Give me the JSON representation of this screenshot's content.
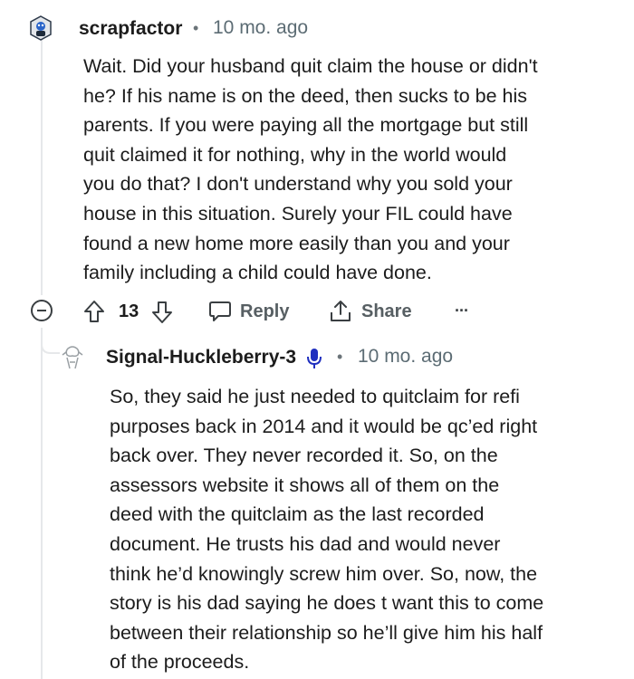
{
  "comment": {
    "username": "scrapfactor",
    "separator": "•",
    "time": "10 mo. ago",
    "lines": [
      "Wait. Did your husband quit claim the house or didn't",
      "he? If his name is on the deed, then sucks to be his",
      "parents. If you were paying all the mortgage but still",
      "quit claimed it for nothing, why in the world would",
      "you do that? I don't understand why you sold your",
      "house in this situation. Surely your FIL could have",
      "found a new home more easily than you and your",
      "family including a child could have done."
    ],
    "votes": "13",
    "reply_label": "Reply",
    "share_label": "Share",
    "more_label": "···"
  },
  "reply": {
    "username": "Signal-Huckleberry-3",
    "separator": "•",
    "time": "10 mo. ago",
    "lines": [
      "So, they said he just needed to quitclaim for refi",
      "purposes back in 2014 and it would be qc’ed right",
      "back over. They never recorded it. So, on the",
      "assessors website it shows all of them on the",
      "deed with the quitclaim as the last recorded",
      "document. He trusts his dad and would never",
      "think he’d knowingly screw him over. So, now, the",
      "story is his dad saying he does t want this to come",
      "between their relationship so he’ll give him his half",
      "of the proceeds."
    ]
  }
}
